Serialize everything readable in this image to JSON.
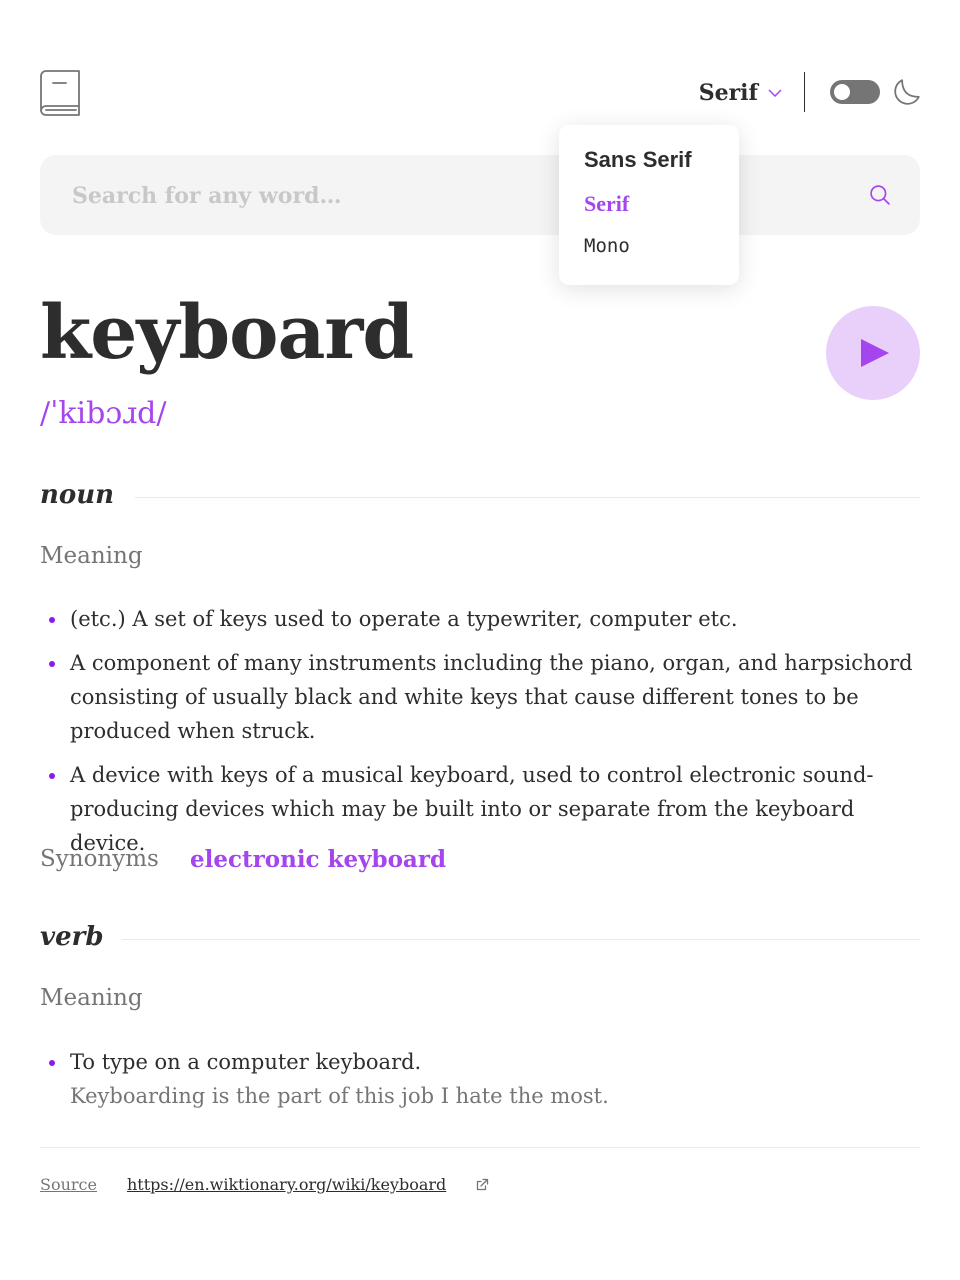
{
  "header": {
    "logo_icon": "book-icon",
    "font_select": {
      "selected": "Serif",
      "icon": "chevron-down-icon"
    },
    "theme_toggle": {
      "state": "off",
      "icon": "moon-icon"
    }
  },
  "font_dropdown": {
    "options": [
      "Sans Serif",
      "Serif",
      "Mono"
    ],
    "selected_index": 1
  },
  "search": {
    "placeholder": "Search for any word…",
    "value": "",
    "icon": "search-icon"
  },
  "entry": {
    "word": "keyboard",
    "phonetic": "/ˈkibɔɹd/",
    "play_icon": "play-icon",
    "meanings": [
      {
        "part_of_speech": "noun",
        "heading": "Meaning",
        "definitions": [
          "(etc.) A set of keys used to operate a typewriter, computer etc.",
          "A component of many instruments including the piano, organ, and harpsichord consisting of usually black and white keys that cause different tones to be produced when struck.",
          "A device with keys of a musical keyboard, used to control electronic sound-producing devices which may be built into or separate from the keyboard device."
        ],
        "synonyms_label": "Synonyms",
        "synonyms": [
          "electronic keyboard"
        ]
      },
      {
        "part_of_speech": "verb",
        "heading": "Meaning",
        "definitions": [
          {
            "text": "To type on a computer keyboard.",
            "example": "Keyboarding is the part of this job I hate the most."
          }
        ]
      }
    ]
  },
  "footer": {
    "source_label": "Source",
    "source_url": "https://en.wiktionary.org/wiki/keyboard",
    "link_icon": "external-link-icon"
  },
  "colors": {
    "accent": "#a445ed",
    "text": "#2d2d2d",
    "muted": "#757575",
    "search_bg": "#f4f4f4",
    "play_bg": "#e9d0fa"
  }
}
